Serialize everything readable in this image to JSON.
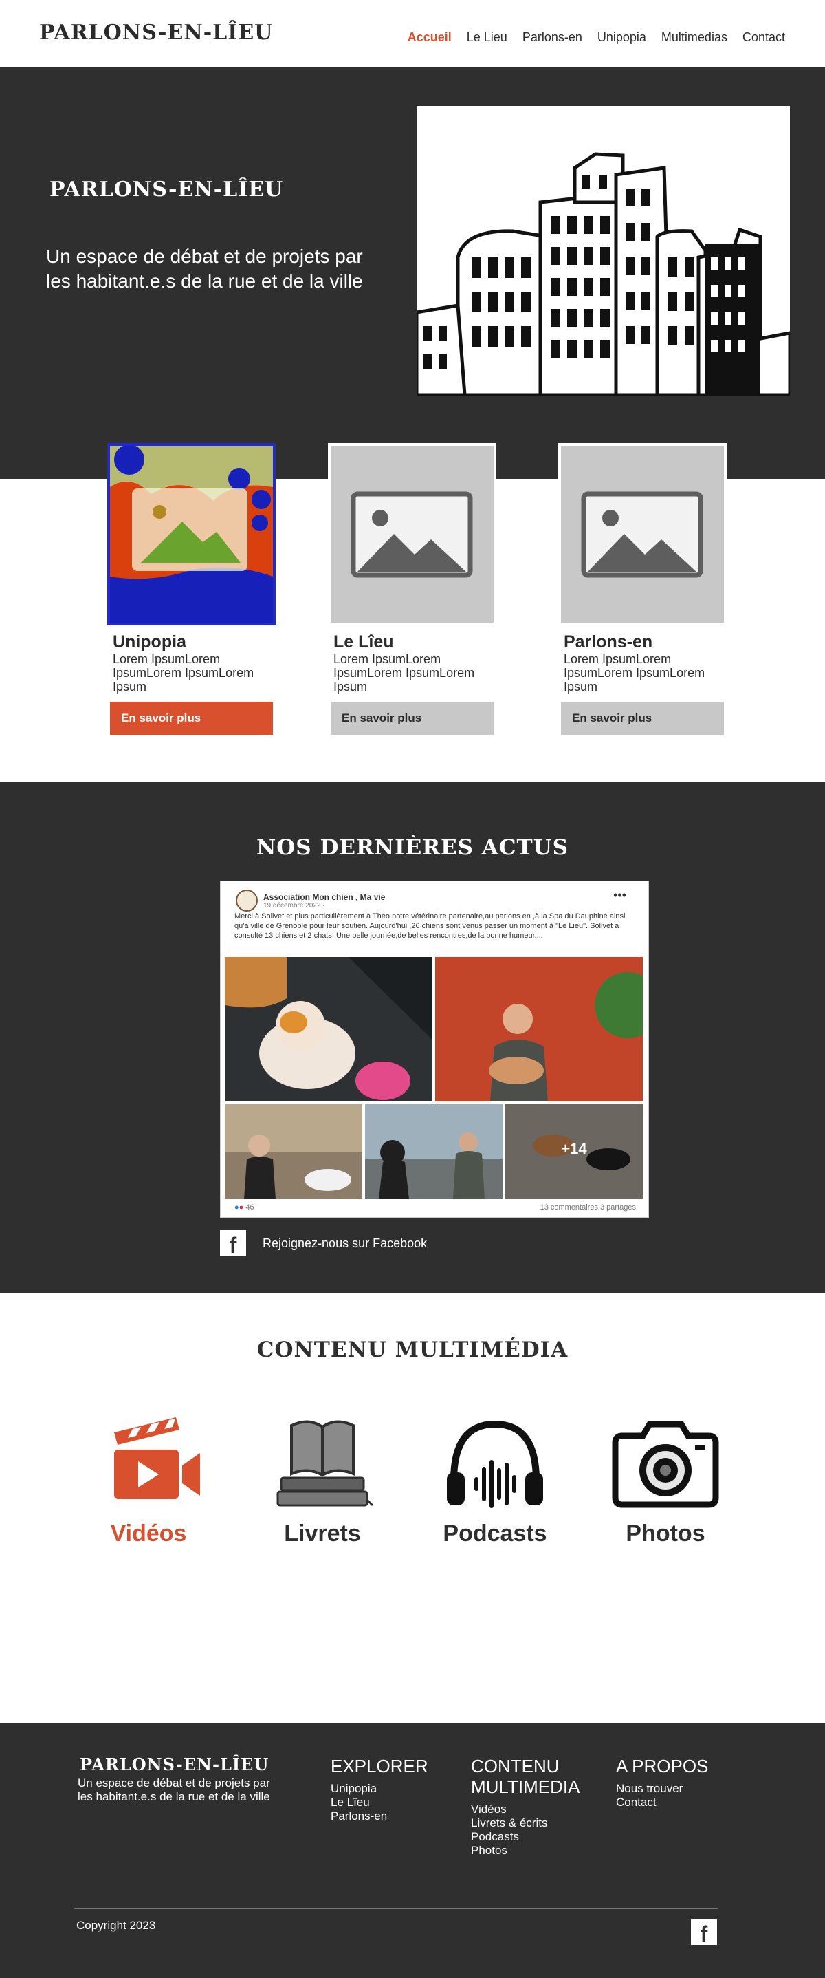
{
  "header": {
    "logo": "PARLONS-EN-LÎEU",
    "nav": [
      {
        "label": "Accueil",
        "active": true
      },
      {
        "label": "Le Lieu"
      },
      {
        "label": "Parlons-en"
      },
      {
        "label": "Unipopia"
      },
      {
        "label": "Multimedias"
      },
      {
        "label": "Contact"
      }
    ]
  },
  "hero": {
    "logo": "PARLONS-EN-LÎEU",
    "subtitle": "Un espace de débat et de projets par les habitant.e.s de la rue et de la ville"
  },
  "cards": [
    {
      "title": "Unipopia",
      "text": "Lorem IpsumLorem IpsumLorem IpsumLorem Ipsum",
      "button": "En savoir plus"
    },
    {
      "title": "Le Lîeu",
      "text": "Lorem IpsumLorem IpsumLorem IpsumLorem Ipsum",
      "button": "En savoir plus"
    },
    {
      "title": "Parlons-en",
      "text": "Lorem IpsumLorem IpsumLorem IpsumLorem Ipsum",
      "button": "En savoir plus"
    }
  ],
  "actus": {
    "title": "NOS DERNIÈRES ACTUS",
    "post": {
      "author": "Association Mon chien , Ma vie",
      "date": "19 décembre 2022 · ",
      "text": "Merci à Solivet et plus particulièrement à Théo notre vétérinaire partenaire,au parlons en ,à la Spa du Dauphiné ainsi qu'a ville de Grenoble pour leur soutien. Aujourd'hui ,26 chiens sont venus passer un moment à \"Le Lieu\". Solivet a consulté  13 chiens et 2 chats. Une belle journée,de belles rencontres,de la bonne humeur....",
      "more_photos": "+14",
      "reactions": "46",
      "stats": "13 commentaires   3 partages"
    },
    "join": "Rejoignez-nous sur Facebook"
  },
  "multimedia": {
    "title": "CONTENU MULTIMÉDIA",
    "items": [
      {
        "label": "Vidéos",
        "icon": "video-camera-icon"
      },
      {
        "label": "Livrets",
        "icon": "books-icon"
      },
      {
        "label": "Podcasts",
        "icon": "headphones-icon"
      },
      {
        "label": "Photos",
        "icon": "camera-icon"
      }
    ]
  },
  "footer": {
    "logo": "PARLONS-EN-LÎEU",
    "subtitle": "Un espace de débat et de projets par les habitant.e.s de la rue et de la ville",
    "explorer": {
      "title": "EXPLORER",
      "links": [
        "Unipopia",
        "Le Lîeu",
        "Parlons-en"
      ]
    },
    "multimedia": {
      "title": "CONTENU MULTIMEDIA",
      "links": [
        "Vidéos",
        "Livrets & écrits",
        "Podcasts",
        "Photos"
      ]
    },
    "apropos": {
      "title": "A PROPOS",
      "links": [
        "Nous trouver",
        "Contact"
      ]
    },
    "copyright": "Copyright 2023",
    "fb_icon": "f"
  },
  "colors": {
    "accent": "#d9502f",
    "dark": "#2f2f2f",
    "placeholder": "#c8c8c8"
  }
}
